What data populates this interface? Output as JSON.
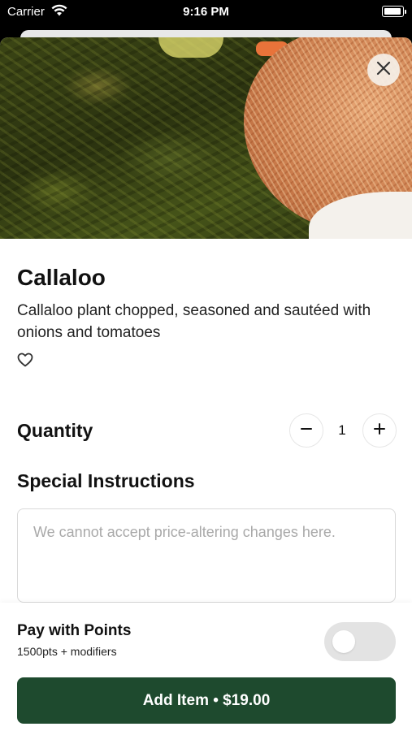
{
  "status_bar": {
    "carrier": "Carrier",
    "time": "9:16 PM",
    "icons": [
      "wifi-icon",
      "battery-icon"
    ]
  },
  "item": {
    "name": "Callaloo",
    "description": "Callaloo plant chopped, seasoned and sautéed with onions and tomatoes",
    "favorite_icon": "heart-outline-icon"
  },
  "quantity": {
    "label": "Quantity",
    "value": "1",
    "decrement_icon": "minus-icon",
    "increment_icon": "plus-icon"
  },
  "instructions": {
    "label": "Special Instructions",
    "placeholder": "We cannot accept price-altering changes here.",
    "value": ""
  },
  "points": {
    "title": "Pay with Points",
    "subtitle": "1500pts + modifiers",
    "enabled": false
  },
  "add_button": {
    "label": "Add Item • $19.00"
  },
  "colors": {
    "primary": "#1e4a2e",
    "toggle_off": "#e3e3e3"
  }
}
